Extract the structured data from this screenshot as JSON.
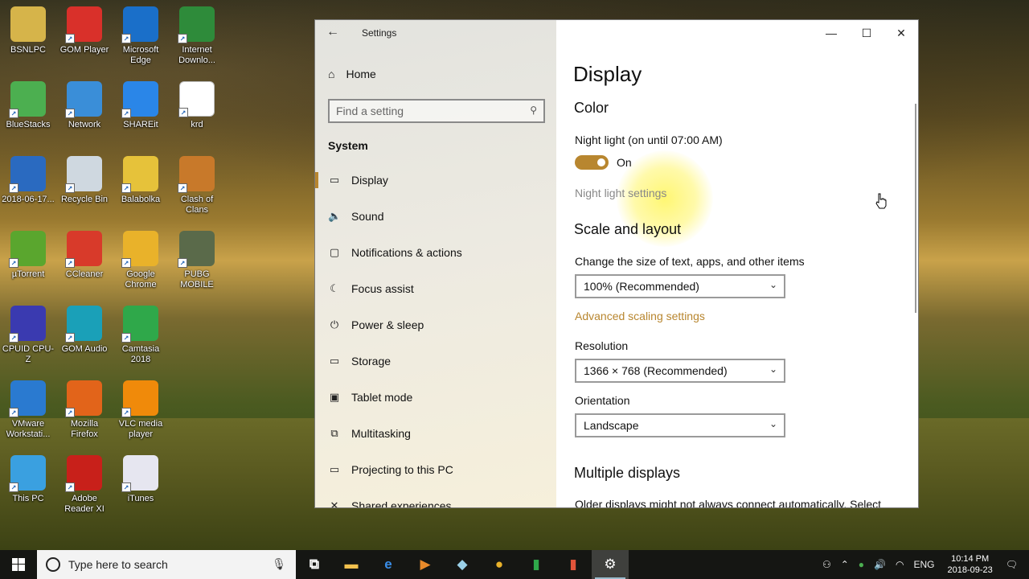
{
  "desktop": {
    "icons": [
      {
        "label": "BSNLPC",
        "icon": "user-folder-icon",
        "color": "#d6b44a"
      },
      {
        "label": "GOM Player",
        "icon": "gom-player-icon",
        "color": "#d9302a"
      },
      {
        "label": "Microsoft Edge",
        "icon": "edge-icon",
        "color": "#1a6fc9"
      },
      {
        "label": "Internet Downlo...",
        "icon": "internet-download-manager-icon",
        "color": "#2e8b3a"
      },
      {
        "label": "BlueStacks",
        "icon": "bluestacks-icon",
        "color": "#4caf50"
      },
      {
        "label": "Network",
        "icon": "network-icon",
        "color": "#3a8ed8"
      },
      {
        "label": "SHAREit",
        "icon": "shareit-icon",
        "color": "#2a86e8"
      },
      {
        "label": "krd",
        "icon": "blank-file-icon",
        "color": "#ffffff"
      },
      {
        "label": "2018-06-17...",
        "icon": "video-thumbnail-icon",
        "color": "#2a6ac0"
      },
      {
        "label": "Recycle Bin",
        "icon": "recycle-bin-icon",
        "color": "#cfd8e0"
      },
      {
        "label": "Balabolka",
        "icon": "balabolka-icon",
        "color": "#e6c23a"
      },
      {
        "label": "Clash of Clans",
        "icon": "clash-of-clans-icon",
        "color": "#c8792a"
      },
      {
        "label": "µTorrent",
        "icon": "utorrent-icon",
        "color": "#5aa62e"
      },
      {
        "label": "CCleaner",
        "icon": "ccleaner-icon",
        "color": "#d83a2a"
      },
      {
        "label": "Google Chrome",
        "icon": "chrome-icon",
        "color": "#e9b22a"
      },
      {
        "label": "PUBG MOBILE",
        "icon": "pubg-mobile-icon",
        "color": "#5a6a4a"
      },
      {
        "label": "CPUID CPU-Z",
        "icon": "cpu-z-icon",
        "color": "#3a3ab0"
      },
      {
        "label": "GOM Audio",
        "icon": "gom-audio-icon",
        "color": "#1aa0b8"
      },
      {
        "label": "Camtasia 2018",
        "icon": "camtasia-icon",
        "color": "#2fa84a"
      },
      {
        "label": "",
        "icon": "empty-slot",
        "color": ""
      },
      {
        "label": "VMware Workstati...",
        "icon": "vmware-icon",
        "color": "#2a7ad0"
      },
      {
        "label": "Mozilla Firefox",
        "icon": "firefox-icon",
        "color": "#e2641a"
      },
      {
        "label": "VLC media player",
        "icon": "vlc-icon",
        "color": "#f08a0a"
      },
      {
        "label": "",
        "icon": "empty-slot",
        "color": ""
      },
      {
        "label": "This PC",
        "icon": "this-pc-icon",
        "color": "#3aa0e0"
      },
      {
        "label": "Adobe Reader XI",
        "icon": "adobe-reader-icon",
        "color": "#c8201a"
      },
      {
        "label": "iTunes",
        "icon": "itunes-icon",
        "color": "#e6e6f0"
      }
    ]
  },
  "window": {
    "title": "Settings",
    "controls": {
      "minimize": "—",
      "maximize": "☐",
      "close": "✕"
    },
    "sidebar": {
      "home_label": "Home",
      "search_placeholder": "Find a setting",
      "section": "System",
      "items": [
        {
          "label": "Display",
          "icon": "monitor-icon",
          "glyph": "▭",
          "active": true
        },
        {
          "label": "Sound",
          "icon": "speaker-icon",
          "glyph": "🔈",
          "active": false
        },
        {
          "label": "Notifications & actions",
          "icon": "notification-icon",
          "glyph": "▢",
          "active": false
        },
        {
          "label": "Focus assist",
          "icon": "moon-icon",
          "glyph": "☾",
          "active": false
        },
        {
          "label": "Power & sleep",
          "icon": "power-icon",
          "glyph": "⏻",
          "active": false
        },
        {
          "label": "Storage",
          "icon": "storage-icon",
          "glyph": "▭",
          "active": false
        },
        {
          "label": "Tablet mode",
          "icon": "tablet-icon",
          "glyph": "▣",
          "active": false
        },
        {
          "label": "Multitasking",
          "icon": "multitasking-icon",
          "glyph": "⧉",
          "active": false
        },
        {
          "label": "Projecting to this PC",
          "icon": "projecting-icon",
          "glyph": "▭",
          "active": false
        },
        {
          "label": "Shared experiences",
          "icon": "shared-experiences-icon",
          "glyph": "✕",
          "active": false
        }
      ]
    },
    "content": {
      "heading": "Display",
      "color_section": "Color",
      "night_light_label": "Night light (on until 07:00 AM)",
      "night_light_state": "On",
      "night_light_link": "Night light settings",
      "scale_section": "Scale and layout",
      "scale_label": "Change the size of text, apps, and other items",
      "scale_value": "100% (Recommended)",
      "advanced_scaling_link": "Advanced scaling settings",
      "resolution_label": "Resolution",
      "resolution_value": "1366 × 768 (Recommended)",
      "orientation_label": "Orientation",
      "orientation_value": "Landscape",
      "multiple_section": "Multiple displays",
      "multiple_desc": "Older displays might not always connect automatically. Select"
    },
    "accent": "#b8862f"
  },
  "taskbar": {
    "search_placeholder": "Type here to search",
    "apps": [
      {
        "icon": "task-view-icon",
        "glyph": "⧉",
        "color": "#ffffff",
        "active": false
      },
      {
        "icon": "file-explorer-icon",
        "glyph": "▬",
        "color": "#f2c14e",
        "active": false
      },
      {
        "icon": "edge-icon",
        "glyph": "e",
        "color": "#3a8ee8",
        "active": false
      },
      {
        "icon": "media-player-icon",
        "glyph": "▶",
        "color": "#e88a2a",
        "active": false
      },
      {
        "icon": "notes-icon",
        "glyph": "◆",
        "color": "#9ad0e8",
        "active": false
      },
      {
        "icon": "chrome-icon",
        "glyph": "●",
        "color": "#e9b22a",
        "active": false
      },
      {
        "icon": "camtasia-icon",
        "glyph": "▮",
        "color": "#2fa84a",
        "active": false
      },
      {
        "icon": "camtasia-recorder-icon",
        "glyph": "▮",
        "color": "#e2543a",
        "active": false
      },
      {
        "icon": "settings-gear-icon",
        "glyph": "⚙",
        "color": "#ffffff",
        "active": true
      }
    ],
    "tray": {
      "language": "ENG",
      "time": "10:14 PM",
      "date": "2018-09-23"
    }
  }
}
